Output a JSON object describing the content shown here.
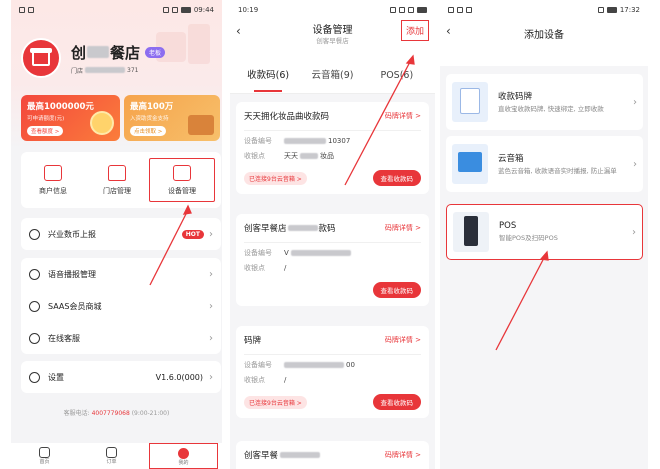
{
  "colors": {
    "accent": "#e8363a",
    "badge": "#8c6df0"
  },
  "phone1": {
    "status": {
      "left": "",
      "time": "09:44"
    },
    "store": {
      "name_suffix": "餐店",
      "badge": "老板",
      "id_prefix": "门店",
      "id_suffix": "371"
    },
    "promos": [
      {
        "title": "最高1000000元",
        "sub": "可申请额度(元)",
        "btn": "查看额度 >"
      },
      {
        "title": "最高100万",
        "sub": "入资助货金支持",
        "btn": "点击领取 >"
      }
    ],
    "menu": [
      {
        "label": "商户信息",
        "icon": "merchant-info-icon"
      },
      {
        "label": "门店管理",
        "icon": "store-manage-icon"
      },
      {
        "label": "设备管理",
        "icon": "device-manage-icon"
      }
    ],
    "list_a": [
      {
        "label": "兴业数币上报",
        "tag": "HOT",
        "icon": "currency-icon"
      }
    ],
    "list_b": [
      {
        "label": "语音播报管理",
        "icon": "voice-broadcast-icon"
      },
      {
        "label": "SAAS会员商城",
        "icon": "mall-icon"
      },
      {
        "label": "在线客服",
        "icon": "headset-icon"
      }
    ],
    "list_c": [
      {
        "label": "设置",
        "value": "V1.6.0(000)",
        "icon": "settings-icon"
      }
    ],
    "contact": {
      "prefix": "客服电话: ",
      "tel": "4007779068",
      "hours": "(9:00-21:00)"
    },
    "tabs": [
      {
        "label": "首页",
        "icon": "home-icon"
      },
      {
        "label": "订单",
        "icon": "order-icon"
      },
      {
        "label": "我的",
        "icon": "profile-icon"
      }
    ]
  },
  "phone2": {
    "status": {
      "time": "10:19"
    },
    "title": "设备管理",
    "subtitle": "创客早餐店",
    "add": "添加",
    "tabs": [
      "收款码(6)",
      "云音箱(9)",
      "POS(6)"
    ],
    "cards": [
      {
        "title": "天天拥化妆品曲收款码",
        "link": "码牌详情 >",
        "k1": "设备编号",
        "v1": "10307",
        "k2": "收银点",
        "v2": "天天",
        "v2b": "妆品",
        "pill": "已连接9台云音箱 >",
        "btn": "查看收款码"
      },
      {
        "title": "创客早餐店",
        "title_b": "款码",
        "link": "码牌详情 >",
        "k1": "设备编号",
        "v1": "V",
        "k2": "收银点",
        "v2": "/",
        "v2b": "",
        "pill": "",
        "btn": "查看收款码"
      },
      {
        "title": "码牌",
        "link": "码牌详情 >",
        "k1": "设备编号",
        "v1": "00",
        "k2": "收银点",
        "v2": "/",
        "v2b": "",
        "pill": "已连接9台云音箱 >",
        "btn": "查看收款码"
      },
      {
        "title": "创客早餐",
        "link": "码牌详情 >"
      }
    ]
  },
  "phone3": {
    "status": {
      "time": "17:32"
    },
    "title": "添加设备",
    "devices": [
      {
        "title": "收款码牌",
        "desc": "直收宝收款码牌, 快速绑定, 立即收款",
        "icon": "qr-stand-icon"
      },
      {
        "title": "云音箱",
        "desc": "蓝色云音箱, 收款语音实时播报, 防止漏单",
        "icon": "cloud-speaker-icon"
      },
      {
        "title": "POS",
        "desc": "智能POS及扫码POS",
        "icon": "pos-terminal-icon"
      }
    ]
  }
}
